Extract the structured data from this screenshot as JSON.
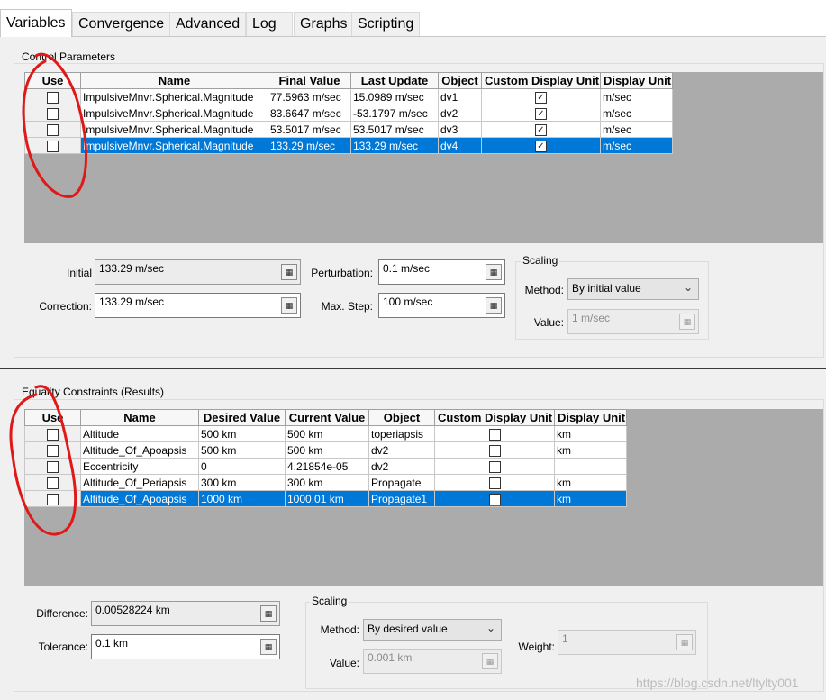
{
  "tabs": [
    {
      "label": "Variables",
      "active": true
    },
    {
      "label": "Convergence",
      "active": false
    },
    {
      "label": "Advanced",
      "active": false
    },
    {
      "label": "Log",
      "active": false
    },
    {
      "label": "Graphs",
      "active": false
    },
    {
      "label": "Scripting",
      "active": false
    }
  ],
  "control": {
    "group_title": "Control Parameters",
    "columns": [
      "Use",
      "Name",
      "Final Value",
      "Last Update",
      "Object",
      "Custom Display Unit",
      "Display Unit"
    ],
    "rows": [
      {
        "use": false,
        "name": "ImpulsiveMnvr.Spherical.Magnitude",
        "final": "77.5963 m/sec",
        "last": "15.0989 m/sec",
        "object": "dv1",
        "custom_unit": true,
        "display_unit": "m/sec",
        "selected": false
      },
      {
        "use": false,
        "name": "ImpulsiveMnvr.Spherical.Magnitude",
        "final": "83.6647 m/sec",
        "last": "-53.1797 m/sec",
        "object": "dv2",
        "custom_unit": true,
        "display_unit": "m/sec",
        "selected": false
      },
      {
        "use": false,
        "name": "ImpulsiveMnvr.Spherical.Magnitude",
        "final": "53.5017 m/sec",
        "last": "53.5017 m/sec",
        "object": "dv3",
        "custom_unit": true,
        "display_unit": "m/sec",
        "selected": false
      },
      {
        "use": false,
        "name": "ImpulsiveMnvr.Spherical.Magnitude",
        "final": "133.29 m/sec",
        "last": "133.29 m/sec",
        "object": "dv4",
        "custom_unit": true,
        "display_unit": "m/sec",
        "selected": true
      }
    ],
    "initial_label": "Initial",
    "initial_value": "133.29 m/sec",
    "correction_label": "Correction:",
    "correction_value": "133.29 m/sec",
    "perturbation_label": "Perturbation:",
    "perturbation_value": "0.1 m/sec",
    "maxstep_label": "Max. Step:",
    "maxstep_value": "100 m/sec",
    "scaling": {
      "title": "Scaling",
      "method_label": "Method:",
      "method_value": "By initial value",
      "value_label": "Value:",
      "value_value": "1 m/sec"
    }
  },
  "constraints": {
    "group_title": "Equality Constraints (Results)",
    "columns": [
      "Use",
      "Name",
      "Desired Value",
      "Current Value",
      "Object",
      "Custom Display Unit",
      "Display Unit"
    ],
    "rows": [
      {
        "use": false,
        "name": "Altitude",
        "desired": "500 km",
        "current": "500 km",
        "object": "toperiapsis",
        "custom_unit": false,
        "display_unit": "km",
        "selected": false
      },
      {
        "use": false,
        "name": "Altitude_Of_Apoapsis",
        "desired": "500 km",
        "current": "500 km",
        "object": "dv2",
        "custom_unit": false,
        "display_unit": "km",
        "selected": false
      },
      {
        "use": false,
        "name": "Eccentricity",
        "desired": "0",
        "current": "4.21854e-05",
        "object": "dv2",
        "custom_unit": false,
        "display_unit": "",
        "selected": false
      },
      {
        "use": false,
        "name": "Altitude_Of_Periapsis",
        "desired": "300 km",
        "current": "300 km",
        "object": "Propagate",
        "custom_unit": false,
        "display_unit": "km",
        "selected": false
      },
      {
        "use": false,
        "name": "Altitude_Of_Apoapsis",
        "desired": "1000 km",
        "current": "1000.01 km",
        "object": "Propagate1",
        "custom_unit": false,
        "display_unit": "km",
        "selected": true
      }
    ],
    "difference_label": "Difference:",
    "difference_value": "0.00528224 km",
    "tolerance_label": "Tolerance:",
    "tolerance_value": "0.1 km",
    "scaling": {
      "title": "Scaling",
      "method_label": "Method:",
      "method_value": "By desired value",
      "value_label": "Value:",
      "value_value": "0.001 km",
      "weight_label": "Weight:",
      "weight_value": "1"
    }
  },
  "watermark": "https://blog.csdn.net/ltylty001",
  "colors": {
    "selection": "#0078d7",
    "annotation": "#e01818",
    "panel": "#f0f0f0"
  }
}
